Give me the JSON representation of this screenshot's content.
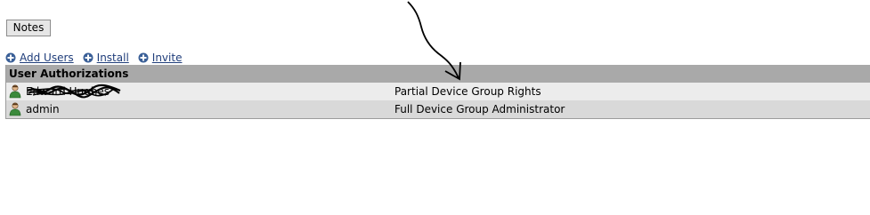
{
  "toolbar": {
    "notes_label": "Notes"
  },
  "actions": [
    {
      "label": "Add Users",
      "icon": "plus-circle-icon"
    },
    {
      "label": "Install",
      "icon": "plus-circle-icon"
    },
    {
      "label": "Invite",
      "icon": "plus-circle-icon"
    }
  ],
  "table": {
    "header": "User Authorizations",
    "rows": [
      {
        "user": "Edward Hughes",
        "rights": "Partial Device Group Rights",
        "redacted": true
      },
      {
        "user": "admin",
        "rights": "Full Device Group Administrator",
        "redacted": false
      }
    ]
  },
  "colors": {
    "link": "#1f3d7a",
    "header_bg": "#a9a9a9",
    "row_odd": "#ececec",
    "row_even": "#d9d9d9",
    "icon_blue": "#3a5f97"
  }
}
